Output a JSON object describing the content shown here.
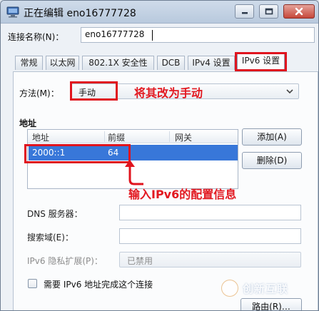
{
  "window": {
    "title": "正在编辑 eno16777728"
  },
  "connection": {
    "label": "连接名称(N)：",
    "value": "eno16777728"
  },
  "tabs": [
    {
      "label": "常规"
    },
    {
      "label": "以太网"
    },
    {
      "label": "802.1X 安全性"
    },
    {
      "label": "DCB"
    },
    {
      "label": "IPv4 设置"
    },
    {
      "label": "IPv6 设置",
      "active": true
    }
  ],
  "method": {
    "label": "方法(M)：",
    "value": "手动",
    "annotation": "将其改为手动"
  },
  "addresses": {
    "section_title": "地址",
    "columns": [
      "地址",
      "前缀",
      "网关"
    ],
    "rows": [
      {
        "address": "2000::1",
        "prefix": "64",
        "gateway": ""
      }
    ],
    "add_label": "添加(A)",
    "delete_label": "删除(D)",
    "annotation": "输入IPv6的配置信息"
  },
  "dns": {
    "label": "DNS 服务器：",
    "value": ""
  },
  "search_domains": {
    "label": "搜索域(E)：",
    "value": ""
  },
  "privacy": {
    "label": "IPv6 隐私扩展(P)：",
    "value": "已禁用"
  },
  "require": {
    "label": "需要 IPv6 地址完成这个连接",
    "checked": false
  },
  "routes_label": "路由(R)…",
  "watermark": "创新互联",
  "colors": {
    "annotation": "#e0141e",
    "selection": "#3877d9"
  }
}
